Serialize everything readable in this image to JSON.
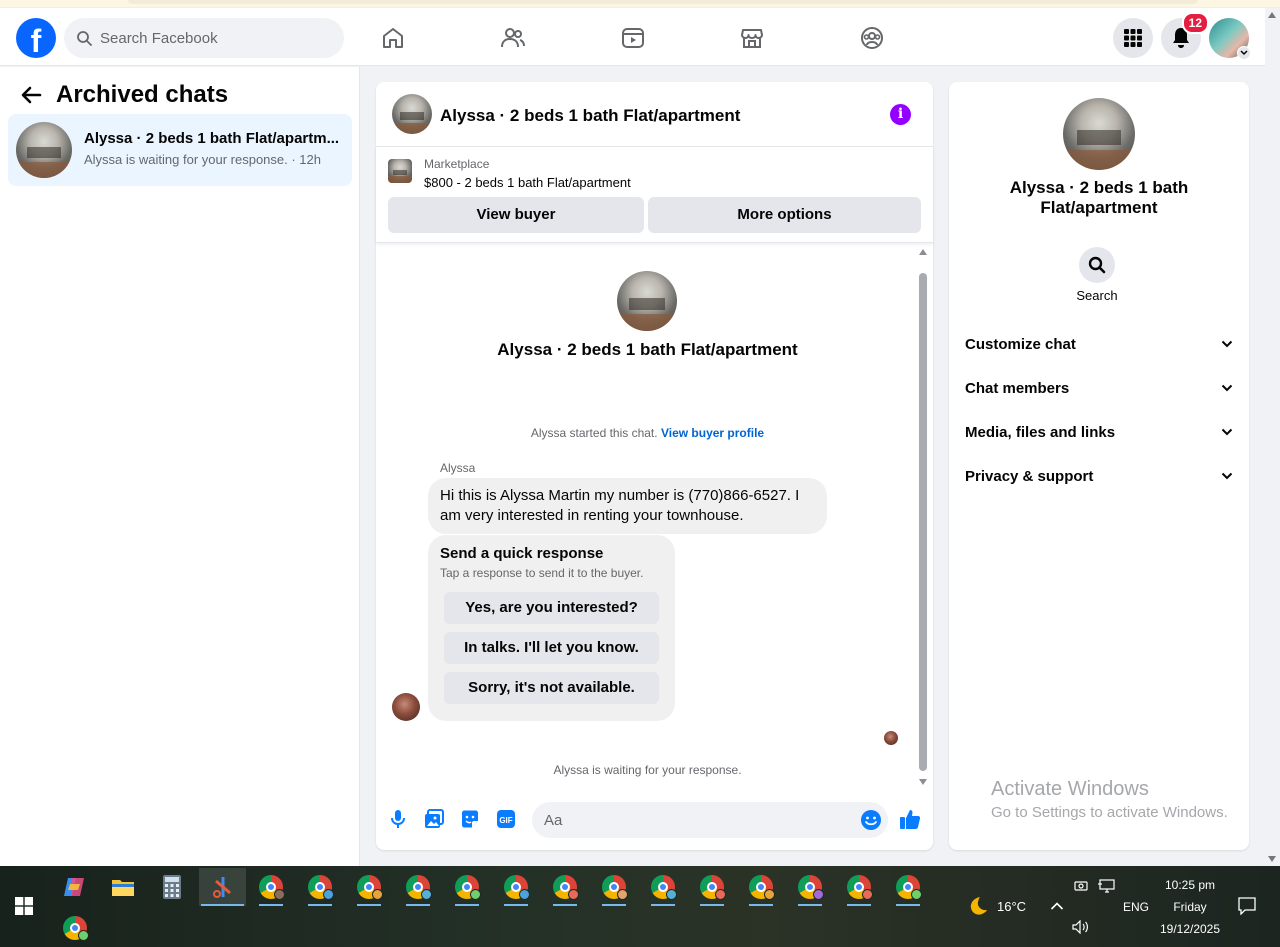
{
  "header": {
    "logo_letter": "f",
    "search_placeholder": "Search Facebook",
    "notifications_count": "12",
    "nav_icons": [
      "home-icon",
      "friends-icon",
      "video-icon",
      "marketplace-icon",
      "groups-icon"
    ]
  },
  "sidebar": {
    "title": "Archived chats",
    "chats": [
      {
        "name": "Alyssa · 2 beds 1 bath Flat/apartm...",
        "preview": "Alyssa is waiting for your response. · 12h"
      }
    ]
  },
  "conversation": {
    "title": "Alyssa · 2 beds 1 bath Flat/apartment",
    "marketplace_label": "Marketplace",
    "listing": "$800 - 2 beds 1 bath Flat/apartment",
    "view_buyer_label": "View buyer",
    "more_options_label": "More options",
    "intro_name": "Alyssa · 2 beds 1 bath Flat/apartment",
    "started_text": "Alyssa started this chat.",
    "view_profile_link": "View buyer profile",
    "sender": "Alyssa",
    "message": "Hi this is Alyssa Martin my number is (770)866-6527. I am very interested in renting your townhouse.",
    "quick_title": "Send a quick response",
    "quick_subtitle": "Tap a response to send it to the buyer.",
    "quick_responses": [
      "Yes, are you interested?",
      "In talks. I'll let you know.",
      "Sorry, it's not available."
    ],
    "waiting_text": "Alyssa is waiting for your response.",
    "composer_placeholder": "Aa"
  },
  "details": {
    "name": "Alyssa · 2 beds 1 bath Flat/apartment",
    "search_label": "Search",
    "sections": [
      "Customize chat",
      "Chat members",
      "Media, files and links",
      "Privacy & support"
    ]
  },
  "watermark": {
    "line1": "Activate Windows",
    "line2": "Go to Settings to activate Windows."
  },
  "taskbar": {
    "weather": "16°C",
    "language": "ENG",
    "time": "10:25 pm",
    "day": "Friday",
    "date": "19/12/2025",
    "chrome_profile_colors": [
      "#8a6d5a",
      "#4aa3df",
      "#e8a33a",
      "#55b0d8",
      "#6fcf6f",
      "#4aa3df",
      "#e86a5a",
      "#e8a36a",
      "#55b0d8",
      "#e86a5a",
      "#e8a33a",
      "#a06ad8",
      "#e86a5a",
      "#6fcf6f",
      "#6fcf6f"
    ]
  },
  "colors": {
    "facebook_blue": "#0866ff",
    "selected_chat_bg": "#ebf5ff",
    "info_purple": "#9300ff",
    "messenger_accent": "#0a7cff",
    "badge_red": "#e41e3f"
  }
}
